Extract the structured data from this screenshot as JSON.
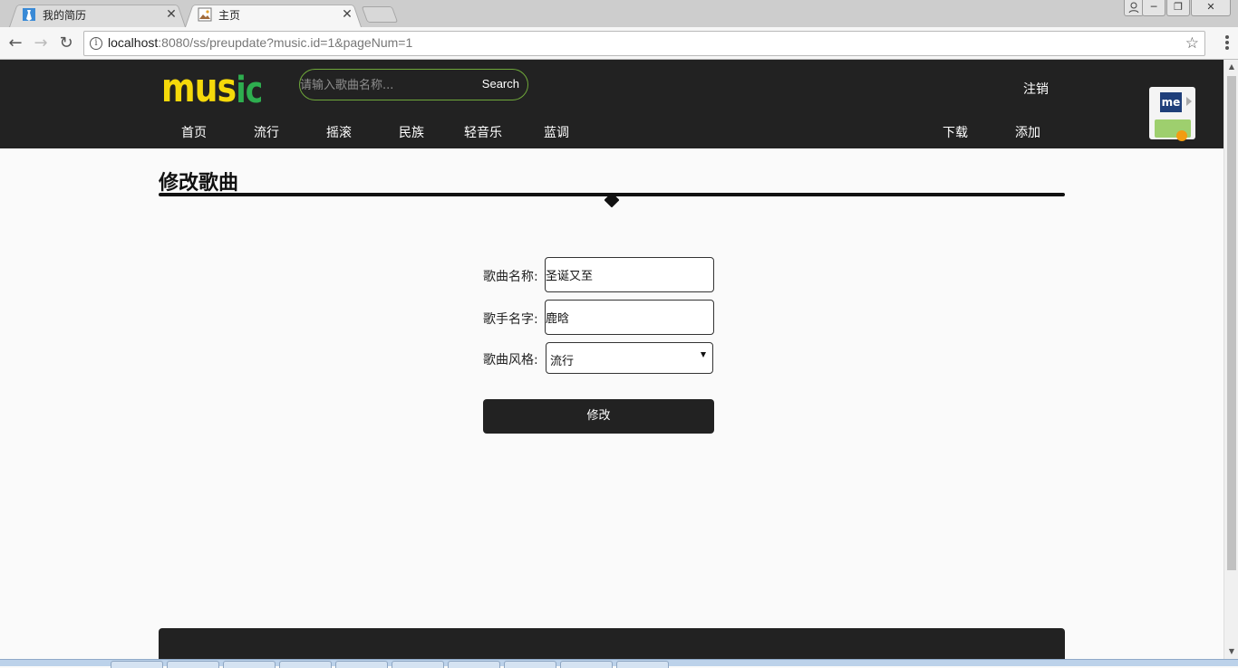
{
  "browser": {
    "tabs": [
      {
        "title": "我的简历",
        "active": false
      },
      {
        "title": "主页",
        "active": true
      }
    ],
    "url_host": "localhost",
    "url_rest": ":8080/ss/preupdate?music.id=1&pageNum=1"
  },
  "site": {
    "logo_letters": [
      {
        "ch": "m",
        "color": "#f5d90a"
      },
      {
        "ch": "u",
        "color": "#f5d90a"
      },
      {
        "ch": "s",
        "color": "#f5d90a"
      },
      {
        "ch": "i",
        "color": "#2eae4f"
      },
      {
        "ch": "c",
        "color": "#2eae4f"
      }
    ],
    "search_placeholder": "请输入歌曲名称...",
    "search_button": "Search",
    "logout": "注销",
    "nav_left": [
      "首页",
      "流行",
      "摇滚",
      "民族",
      "轻音乐",
      "蓝调"
    ],
    "nav_right": [
      "下载",
      "添加"
    ]
  },
  "form": {
    "title": "修改歌曲",
    "song_name_label": "歌曲名称:",
    "song_name_value": "圣诞又至",
    "singer_label": "歌手名字:",
    "singer_value": "鹿晗",
    "genre_label": "歌曲风格:",
    "genre_value": "流行",
    "submit_label": "修改"
  },
  "extension": {
    "logo_text": "me"
  }
}
